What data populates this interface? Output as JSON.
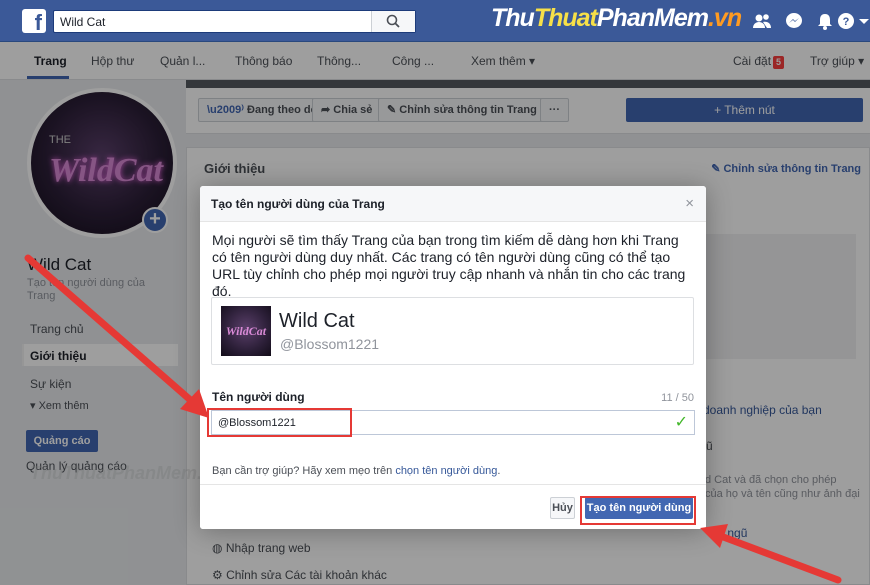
{
  "topbar": {
    "search_value": "Wild Cat",
    "brand": {
      "p1": "Thu",
      "p2": "Thuat",
      "p3": "PhanMem",
      "p4": ".vn"
    },
    "icons": [
      "friends-icon",
      "messenger-icon",
      "notifications-icon",
      "help-icon",
      "dropdown-icon"
    ]
  },
  "tabs": {
    "trang": "Trang",
    "hop_thu": "Hộp thư",
    "quan_ly": "Quản l...",
    "thong_bao": "Thông báo",
    "thong_tin": "Thông...",
    "cong_cu": "Công ...",
    "xem_them": "Xem thêm ▾",
    "cai_dat": "Cài đặt",
    "cai_dat_badge": "5",
    "tro_giup": "Trợ giúp ▾"
  },
  "actions": {
    "following": "Đang theo dõi ▾",
    "share": "Chia sẻ",
    "edit_info": "Chỉnh sửa thông tin Trang",
    "more": "···",
    "add_button": "+ Thêm nút"
  },
  "page": {
    "avatar_the": "THE",
    "avatar_text": "WildCat",
    "name": "Wild Cat",
    "username_hint": "Tạo tên người dùng của Trang"
  },
  "left_nav": {
    "home": "Trang chủ",
    "about": "Giới thiệu",
    "events": "Sự kiện",
    "see_more": "▾ Xem thêm",
    "ads_button": "Quảng cáo",
    "ads_manager": "Quản lý quảng cáo"
  },
  "card": {
    "title": "Giới thiệu",
    "edit_link": "Chỉnh sửa thông tin Trang",
    "bg_business": "doanh nghiệp của bạn",
    "bg_u": "ũ",
    "bg_line1": "d Cat và đã chọn cho phép",
    "bg_line2": "của họ và tên cũng như ảnh đại",
    "bg_team": "đội ngũ",
    "import_web": "Nhập trang web",
    "edit_accounts": "Chỉnh sửa Các tài khoản khác"
  },
  "dialog": {
    "title": "Tạo tên người dùng của Trang",
    "close": "×",
    "description": "Mọi người sẽ tìm thấy Trang của bạn trong tìm kiếm dễ dàng hơn khi Trang có tên người dùng duy nhất. Các trang có tên người dùng cũng có thể tạo URL tùy chỉnh cho phép mọi người truy cập nhanh và nhắn tin cho các trang đó.",
    "preview_name": "Wild Cat",
    "preview_username": "@Blossom1221",
    "preview_thumb_text": "WildCat",
    "field_label": "Tên người dùng",
    "field_count": "11 / 50",
    "field_value": "@Blossom1221",
    "help_prefix": "Bạn cần trợ giúp? Hãy xem mẹo trên ",
    "help_link": "chọn tên người dùng",
    "help_suffix": ".",
    "cancel": "Hủy",
    "submit": "Tạo tên người dùng"
  },
  "watermark": "ThuThuatPhanMem.vn",
  "colors": {
    "facebook_blue": "#3b5998",
    "button_blue": "#4267b2",
    "highlight_red": "#e53935"
  }
}
